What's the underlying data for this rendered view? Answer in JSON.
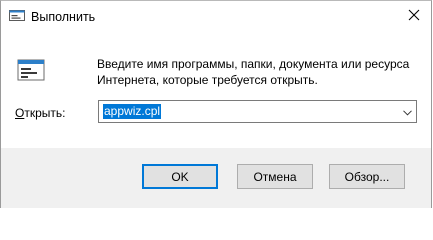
{
  "window": {
    "title": "Выполнить",
    "close_label": "✕"
  },
  "dialog": {
    "description": "Введите имя программы, папки, документа или ресурса Интернета, которые требуется открыть.",
    "open_label": "Открыть:",
    "open_label_accel": "О",
    "open_label_rest": "ткрыть:",
    "command_value": "appwiz.cpl"
  },
  "buttons": {
    "ok": "OK",
    "cancel": "Отмена",
    "browse": "Обзор..."
  },
  "icons": {
    "app": "run-app-icon",
    "run": "run-dialog-icon",
    "close": "close-icon",
    "dropdown": "chevron-down-icon"
  },
  "colors": {
    "selection": "#0078d7",
    "footer_bg": "#f0f0f0",
    "default_button_border": "#0078d7"
  }
}
